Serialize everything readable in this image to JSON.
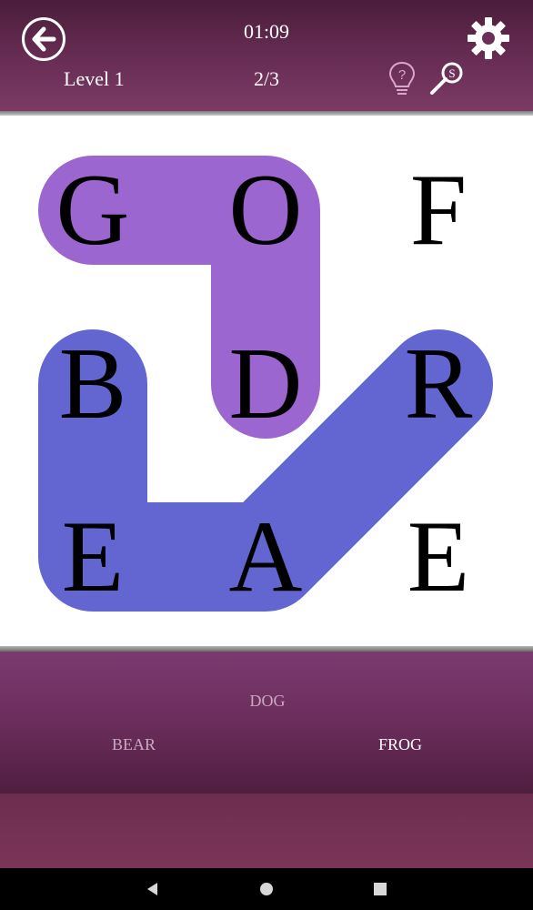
{
  "header": {
    "timer": "01:09",
    "level_label": "Level 1",
    "progress": "2/3",
    "hint_icon": "lightbulb-question-icon",
    "solve_icon": "magnifier-s-icon",
    "settings_icon": "gear-icon",
    "back_icon": "back-arrow-icon"
  },
  "board": {
    "rows": 3,
    "cols": 3,
    "grid": [
      [
        "G",
        "O",
        "F"
      ],
      [
        "B",
        "D",
        "R"
      ],
      [
        "E",
        "A",
        "E"
      ]
    ],
    "found_paths": [
      {
        "word": "DOG",
        "cells": [
          [
            1,
            1
          ],
          [
            0,
            1
          ],
          [
            0,
            0
          ]
        ],
        "color": "#9b66cf"
      },
      {
        "word": "BEAR",
        "cells": [
          [
            1,
            0
          ],
          [
            2,
            0
          ],
          [
            2,
            1
          ],
          [
            1,
            2
          ]
        ],
        "color": "#6366d0"
      }
    ]
  },
  "words": [
    {
      "text": "DOG",
      "status": "found"
    },
    {
      "text": "BEAR",
      "status": "found"
    },
    {
      "text": "FROG",
      "status": "remaining"
    }
  ],
  "colors": {
    "header_bg": "#6b2f57",
    "path_dog": "#9b66cf",
    "path_bear": "#6366d0",
    "word_found": "#c9a9c0",
    "word_remaining": "#ffffff"
  },
  "nav": {
    "back_icon": "nav-back-triangle-icon",
    "home_icon": "nav-home-circle-icon",
    "recents_icon": "nav-recents-square-icon"
  }
}
